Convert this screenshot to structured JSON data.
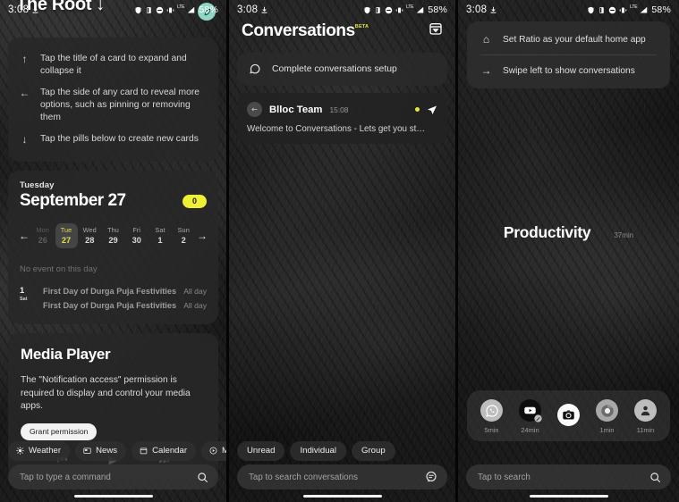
{
  "statusbar": {
    "time": "3:08",
    "battery": "58%",
    "lte_label": "LTE",
    "icons": [
      "shield-icon",
      "battery-saver-icon",
      "dnd-icon",
      "vibrate-icon",
      "signal-icon"
    ]
  },
  "panel1": {
    "title": "The Root",
    "title_chevron": "↓",
    "badge_icon": "leaf-icon",
    "tips_card": {
      "tips": [
        {
          "icon": "↑",
          "icon_name": "arrow-up-icon",
          "text": "Tap the title of a card to expand and collapse it"
        },
        {
          "icon": "←",
          "icon_name": "arrow-left-icon",
          "text": "Tap the side of any card to reveal more options, such as pinning or removing them"
        },
        {
          "icon": "↓",
          "icon_name": "arrow-down-icon",
          "text": "Tap the pills below to create new cards"
        }
      ]
    },
    "calendar": {
      "weekday": "Tuesday",
      "date": "September 27",
      "event_count": "0",
      "prev_arrow": "←",
      "next_arrow": "→",
      "week": [
        {
          "dow": "Mon",
          "num": "26",
          "state": "past"
        },
        {
          "dow": "Tue",
          "num": "27",
          "state": "selected"
        },
        {
          "dow": "Wed",
          "num": "28",
          "state": "normal"
        },
        {
          "dow": "Thu",
          "num": "29",
          "state": "normal"
        },
        {
          "dow": "Fri",
          "num": "30",
          "state": "normal"
        },
        {
          "dow": "Sat",
          "num": "1",
          "state": "normal"
        },
        {
          "dow": "Sun",
          "num": "2",
          "state": "normal"
        }
      ],
      "no_event_text": "No event on this day",
      "event_group": {
        "day_number": "1",
        "day_name": "Sat",
        "events": [
          {
            "name": "First Day of Durga Puja Festivities",
            "when": "All day"
          },
          {
            "name": "First Day of Durga Puja Festivities",
            "when": "All day"
          }
        ]
      }
    },
    "media": {
      "title": "Media Player",
      "description": "The \"Notification access\" permission is required to display and control your media apps.",
      "grant_label": "Grant permission",
      "controls": [
        "⏮",
        "▶",
        "⏭"
      ]
    },
    "pills": [
      {
        "label": "Weather",
        "icon": "sun-icon"
      },
      {
        "label": "News",
        "icon": "news-icon"
      },
      {
        "label": "Calendar",
        "icon": "calendar-icon"
      },
      {
        "label": "Me",
        "icon": "play-circle-icon"
      }
    ],
    "command_bar": {
      "placeholder": "Tap to type a command",
      "icon": "search-icon"
    }
  },
  "panel2": {
    "title": "Conversations",
    "beta": "BETA",
    "archive_icon": "archive-icon",
    "setup": {
      "icon": "chat-bubble-icon",
      "text": "Complete conversations setup"
    },
    "conversation": {
      "avatar_icon": "blloc-avatar-icon",
      "name": "Blloc Team",
      "time": "15:08",
      "unread_dot": true,
      "send_icon": "send-icon",
      "preview": "Welcome to Conversations - Lets get you st…"
    },
    "filters": [
      "Unread",
      "Individual",
      "Group"
    ],
    "search_bar": {
      "placeholder": "Tap to search conversations",
      "icon": "chat-search-icon"
    }
  },
  "panel3": {
    "tips": [
      {
        "icon": "⌂",
        "icon_name": "home-icon",
        "text": "Set Ratio as your default home app"
      },
      {
        "icon": "→",
        "icon_name": "arrow-right-icon",
        "text": "Swipe left to show conversations"
      }
    ],
    "productivity": {
      "label": "Productivity",
      "time": "37min"
    },
    "dock": [
      {
        "icon": "whatsapp-icon",
        "label": "5min"
      },
      {
        "icon": "youtube-icon",
        "label": "24min"
      },
      {
        "icon": "camera-icon",
        "label": ""
      },
      {
        "icon": "chrome-icon",
        "label": "1min"
      },
      {
        "icon": "profile-icon",
        "label": "11min"
      }
    ],
    "search_bar": {
      "placeholder": "Tap to search",
      "icon": "search-icon"
    }
  },
  "colors": {
    "accent_yellow": "#EFEF35",
    "badge_teal": "#8FD6C5",
    "card_bg": "#282828"
  }
}
